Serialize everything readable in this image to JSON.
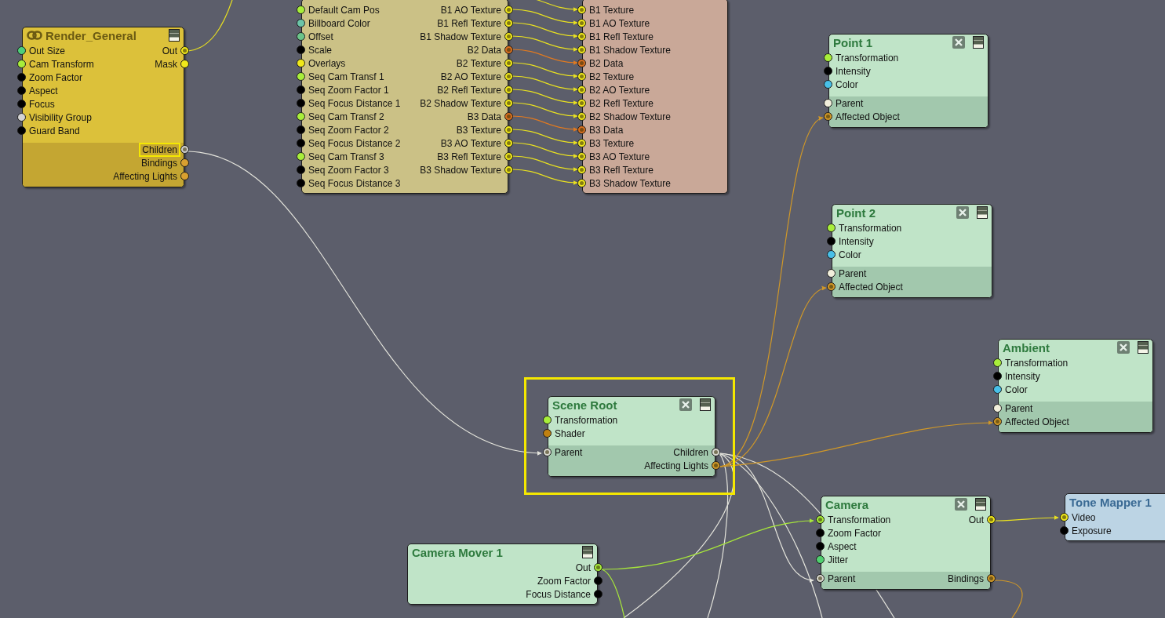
{
  "canvas": {
    "nodes": [
      {
        "title": "Render_General",
        "selected": false,
        "rows": [
          {
            "in": {
              "label": "Out Size",
              "color": "#4fcf7a",
              "linked": false,
              "selected": false
            },
            "out": {
              "label": "Out",
              "color": "#f0e81a",
              "linked": true,
              "selected": false
            }
          },
          {
            "in": {
              "label": "Cam Transform",
              "color": "#a8ee3a",
              "linked": false,
              "selected": false
            },
            "out": {
              "label": "Mask",
              "color": "#f0e81a",
              "linked": false,
              "selected": false
            }
          },
          {
            "in": {
              "label": "Zoom Factor",
              "color": "#000000",
              "linked": false,
              "selected": false
            }
          },
          {
            "in": {
              "label": "Aspect",
              "color": "#000000",
              "linked": false,
              "selected": false
            }
          },
          {
            "in": {
              "label": "Focus",
              "color": "#000000",
              "linked": false,
              "selected": false
            }
          },
          {
            "in": {
              "label": "Visibility Group",
              "color": "#d4d4d4",
              "linked": false,
              "selected": false
            }
          },
          {
            "in": {
              "label": "Guard Band",
              "color": "#000000",
              "linked": false,
              "selected": false
            }
          }
        ],
        "lower_rows": [
          {
            "out": {
              "label": "Children",
              "color": "#cfcfcf",
              "linked": true,
              "selected": true
            }
          },
          {
            "out": {
              "label": "Bindings",
              "color": "#d8a030",
              "linked": false,
              "selected": false
            }
          },
          {
            "out": {
              "label": "Affecting Lights",
              "color": "#d8a030",
              "linked": false,
              "selected": false
            }
          }
        ]
      },
      {
        "selected": false,
        "rows": [
          {
            "in": {
              "label": "Default Cam Pos",
              "color": "#a8ee3a",
              "linked": false,
              "selected": false
            },
            "out": {
              "label": "B1 AO Texture",
              "color": "#f0e81a",
              "linked": true,
              "selected": false
            }
          },
          {
            "in": {
              "label": "Billboard Color",
              "color": "#6cc4a8",
              "linked": false,
              "selected": false
            },
            "out": {
              "label": "B1 Refl Texture",
              "color": "#f0e81a",
              "linked": true,
              "selected": false
            }
          },
          {
            "in": {
              "label": "Offset",
              "color": "#6cc48a",
              "linked": false,
              "selected": false
            },
            "out": {
              "label": "B1 Shadow Texture",
              "color": "#f0e81a",
              "linked": true,
              "selected": false
            }
          },
          {
            "in": {
              "label": "Scale",
              "color": "#000000",
              "linked": false,
              "selected": false
            },
            "out": {
              "label": "B2 Data",
              "color": "#d8701e",
              "linked": true,
              "selected": false
            }
          },
          {
            "in": {
              "label": "Overlays",
              "color": "#f0e81a",
              "linked": false,
              "selected": false
            },
            "out": {
              "label": "B2 Texture",
              "color": "#f0e81a",
              "linked": true,
              "selected": false
            }
          },
          {
            "in": {
              "label": "Seq Cam Transf 1",
              "color": "#a8ee3a",
              "linked": false,
              "selected": false
            },
            "out": {
              "label": "B2 AO Texture",
              "color": "#f0e81a",
              "linked": true,
              "selected": false
            }
          },
          {
            "in": {
              "label": "Seq Zoom Factor 1",
              "color": "#000000",
              "linked": false,
              "selected": false
            },
            "out": {
              "label": "B2 Refl Texture",
              "color": "#f0e81a",
              "linked": true,
              "selected": false
            }
          },
          {
            "in": {
              "label": "Seq Focus Distance 1",
              "color": "#000000",
              "linked": false,
              "selected": false
            },
            "out": {
              "label": "B2 Shadow Texture",
              "color": "#f0e81a",
              "linked": true,
              "selected": false
            }
          },
          {
            "in": {
              "label": "Seq Cam Transf 2",
              "color": "#a8ee3a",
              "linked": false,
              "selected": false
            },
            "out": {
              "label": "B3 Data",
              "color": "#d8701e",
              "linked": true,
              "selected": false
            }
          },
          {
            "in": {
              "label": "Seq Zoom Factor 2",
              "color": "#000000",
              "linked": false,
              "selected": false
            },
            "out": {
              "label": "B3 Texture",
              "color": "#f0e81a",
              "linked": true,
              "selected": false
            }
          },
          {
            "in": {
              "label": "Seq Focus Distance 2",
              "color": "#000000",
              "linked": false,
              "selected": false
            },
            "out": {
              "label": "B3 AO Texture",
              "color": "#f0e81a",
              "linked": true,
              "selected": false
            }
          },
          {
            "in": {
              "label": "Seq Cam Transf 3",
              "color": "#a8ee3a",
              "linked": false,
              "selected": false
            },
            "out": {
              "label": "B3 Refl Texture",
              "color": "#f0e81a",
              "linked": true,
              "selected": false
            }
          },
          {
            "in": {
              "label": "Seq Zoom Factor 3",
              "color": "#000000",
              "linked": false,
              "selected": false
            },
            "out": {
              "label": "B3 Shadow Texture",
              "color": "#f0e81a",
              "linked": true,
              "selected": false
            }
          },
          {
            "in": {
              "label": "Seq Focus Distance 3",
              "color": "#000000",
              "linked": false,
              "selected": false
            }
          }
        ]
      },
      {
        "selected": false,
        "rows": [
          {
            "in": {
              "label": "B1 Texture",
              "color": "#f0e81a",
              "linked": true,
              "selected": false
            }
          },
          {
            "in": {
              "label": "B1 AO Texture",
              "color": "#f0e81a",
              "linked": true,
              "selected": false
            }
          },
          {
            "in": {
              "label": "B1 Refl Texture",
              "color": "#f0e81a",
              "linked": true,
              "selected": false
            }
          },
          {
            "in": {
              "label": "B1 Shadow Texture",
              "color": "#f0e81a",
              "linked": true,
              "selected": false
            }
          },
          {
            "in": {
              "label": "B2 Data",
              "color": "#d8701e",
              "linked": true,
              "selected": false
            }
          },
          {
            "in": {
              "label": "B2 Texture",
              "color": "#f0e81a",
              "linked": true,
              "selected": false
            }
          },
          {
            "in": {
              "label": "B2 AO Texture",
              "color": "#f0e81a",
              "linked": true,
              "selected": false
            }
          },
          {
            "in": {
              "label": "B2 Refl Texture",
              "color": "#f0e81a",
              "linked": true,
              "selected": false
            }
          },
          {
            "in": {
              "label": "B2 Shadow Texture",
              "color": "#f0e81a",
              "linked": true,
              "selected": false
            }
          },
          {
            "in": {
              "label": "B3 Data",
              "color": "#d8701e",
              "linked": true,
              "selected": false
            }
          },
          {
            "in": {
              "label": "B3 Texture",
              "color": "#f0e81a",
              "linked": true,
              "selected": false
            }
          },
          {
            "in": {
              "label": "B3 AO Texture",
              "color": "#f0e81a",
              "linked": true,
              "selected": false
            }
          },
          {
            "in": {
              "label": "B3 Refl Texture",
              "color": "#f0e81a",
              "linked": true,
              "selected": false
            }
          },
          {
            "in": {
              "label": "B3 Shadow Texture",
              "color": "#f0e81a",
              "linked": true,
              "selected": false
            }
          }
        ]
      },
      {
        "title": "Point 1",
        "selected": false,
        "rows": [
          {
            "in": {
              "label": "Transformation",
              "color": "#a8ee3a",
              "linked": false,
              "selected": false
            }
          },
          {
            "in": {
              "label": "Intensity",
              "color": "#000000",
              "linked": false,
              "selected": false
            }
          },
          {
            "in": {
              "label": "Color",
              "color": "#48c0e8",
              "linked": false,
              "selected": false
            }
          }
        ],
        "lower_rows": [
          {
            "in": {
              "label": "Parent",
              "color": "#f2efdc",
              "linked": false,
              "selected": false
            }
          },
          {
            "in": {
              "label": "Affected Object",
              "color": "#d09828",
              "linked": true,
              "selected": false
            }
          }
        ]
      },
      {
        "title": "Point 2",
        "selected": false,
        "rows": [
          {
            "in": {
              "label": "Transformation",
              "color": "#a8ee3a",
              "linked": false,
              "selected": false
            }
          },
          {
            "in": {
              "label": "Intensity",
              "color": "#000000",
              "linked": false,
              "selected": false
            }
          },
          {
            "in": {
              "label": "Color",
              "color": "#48c0e8",
              "linked": false,
              "selected": false
            }
          }
        ],
        "lower_rows": [
          {
            "in": {
              "label": "Parent",
              "color": "#f2efdc",
              "linked": false,
              "selected": false
            }
          },
          {
            "in": {
              "label": "Affected Object",
              "color": "#d09828",
              "linked": true,
              "selected": false
            }
          }
        ]
      },
      {
        "title": "Ambient",
        "selected": false,
        "rows": [
          {
            "in": {
              "label": "Transformation",
              "color": "#a8ee3a",
              "linked": false,
              "selected": false
            }
          },
          {
            "in": {
              "label": "Intensity",
              "color": "#000000",
              "linked": false,
              "selected": false
            }
          },
          {
            "in": {
              "label": "Color",
              "color": "#48c0e8",
              "linked": false,
              "selected": false
            }
          }
        ],
        "lower_rows": [
          {
            "in": {
              "label": "Parent",
              "color": "#f2efdc",
              "linked": false,
              "selected": false
            }
          },
          {
            "in": {
              "label": "Affected Object",
              "color": "#d09828",
              "linked": true,
              "selected": false
            }
          }
        ]
      },
      {
        "title": "Scene Root",
        "selected": true,
        "rows": [
          {
            "in": {
              "label": "Transformation",
              "color": "#a8ee3a",
              "linked": false,
              "selected": false
            }
          },
          {
            "in": {
              "label": "Shader",
              "color": "#c08010",
              "linked": false,
              "selected": false
            }
          }
        ],
        "lower_rows": [
          {
            "in": {
              "label": "Parent",
              "color": "#d8d8d0",
              "linked": true,
              "selected": false
            },
            "out": {
              "label": "Children",
              "color": "#d8d8d0",
              "linked": true,
              "selected": false
            }
          },
          {
            "out": {
              "label": "Affecting Lights",
              "color": "#d09828",
              "linked": true,
              "selected": false
            }
          }
        ]
      },
      {
        "title": "Camera Mover 1",
        "selected": false,
        "rows": [
          {
            "out": {
              "label": "Out",
              "color": "#a8ee3a",
              "linked": true,
              "selected": false
            }
          },
          {
            "out": {
              "label": "Zoom Factor",
              "color": "#000000",
              "linked": false,
              "selected": false
            }
          },
          {
            "out": {
              "label": "Focus Distance",
              "color": "#000000",
              "linked": false,
              "selected": false
            }
          }
        ]
      },
      {
        "title": "Camera",
        "selected": false,
        "rows": [
          {
            "in": {
              "label": "Transformation",
              "color": "#a8ee3a",
              "linked": true,
              "selected": false
            },
            "out": {
              "label": "Out",
              "color": "#f0e81a",
              "linked": true,
              "selected": false
            }
          },
          {
            "in": {
              "label": "Zoom Factor",
              "color": "#000000",
              "linked": false,
              "selected": false
            }
          },
          {
            "in": {
              "label": "Aspect",
              "color": "#000000",
              "linked": false,
              "selected": false
            }
          },
          {
            "in": {
              "label": "Jitter",
              "color": "#50d070",
              "linked": false,
              "selected": false
            }
          }
        ],
        "lower_rows": [
          {
            "in": {
              "label": "Parent",
              "color": "#d8d8d0",
              "linked": true,
              "selected": false
            },
            "out": {
              "label": "Bindings",
              "color": "#d09828",
              "linked": true,
              "selected": false
            }
          }
        ]
      },
      {
        "title": "Tone Mapper 1",
        "selected": false,
        "rows": [
          {
            "in": {
              "label": "Video",
              "color": "#f0e81a",
              "linked": true,
              "selected": false
            }
          },
          {
            "in": {
              "label": "Exposure",
              "color": "#000000",
              "linked": false,
              "selected": false
            }
          }
        ]
      }
    ]
  }
}
